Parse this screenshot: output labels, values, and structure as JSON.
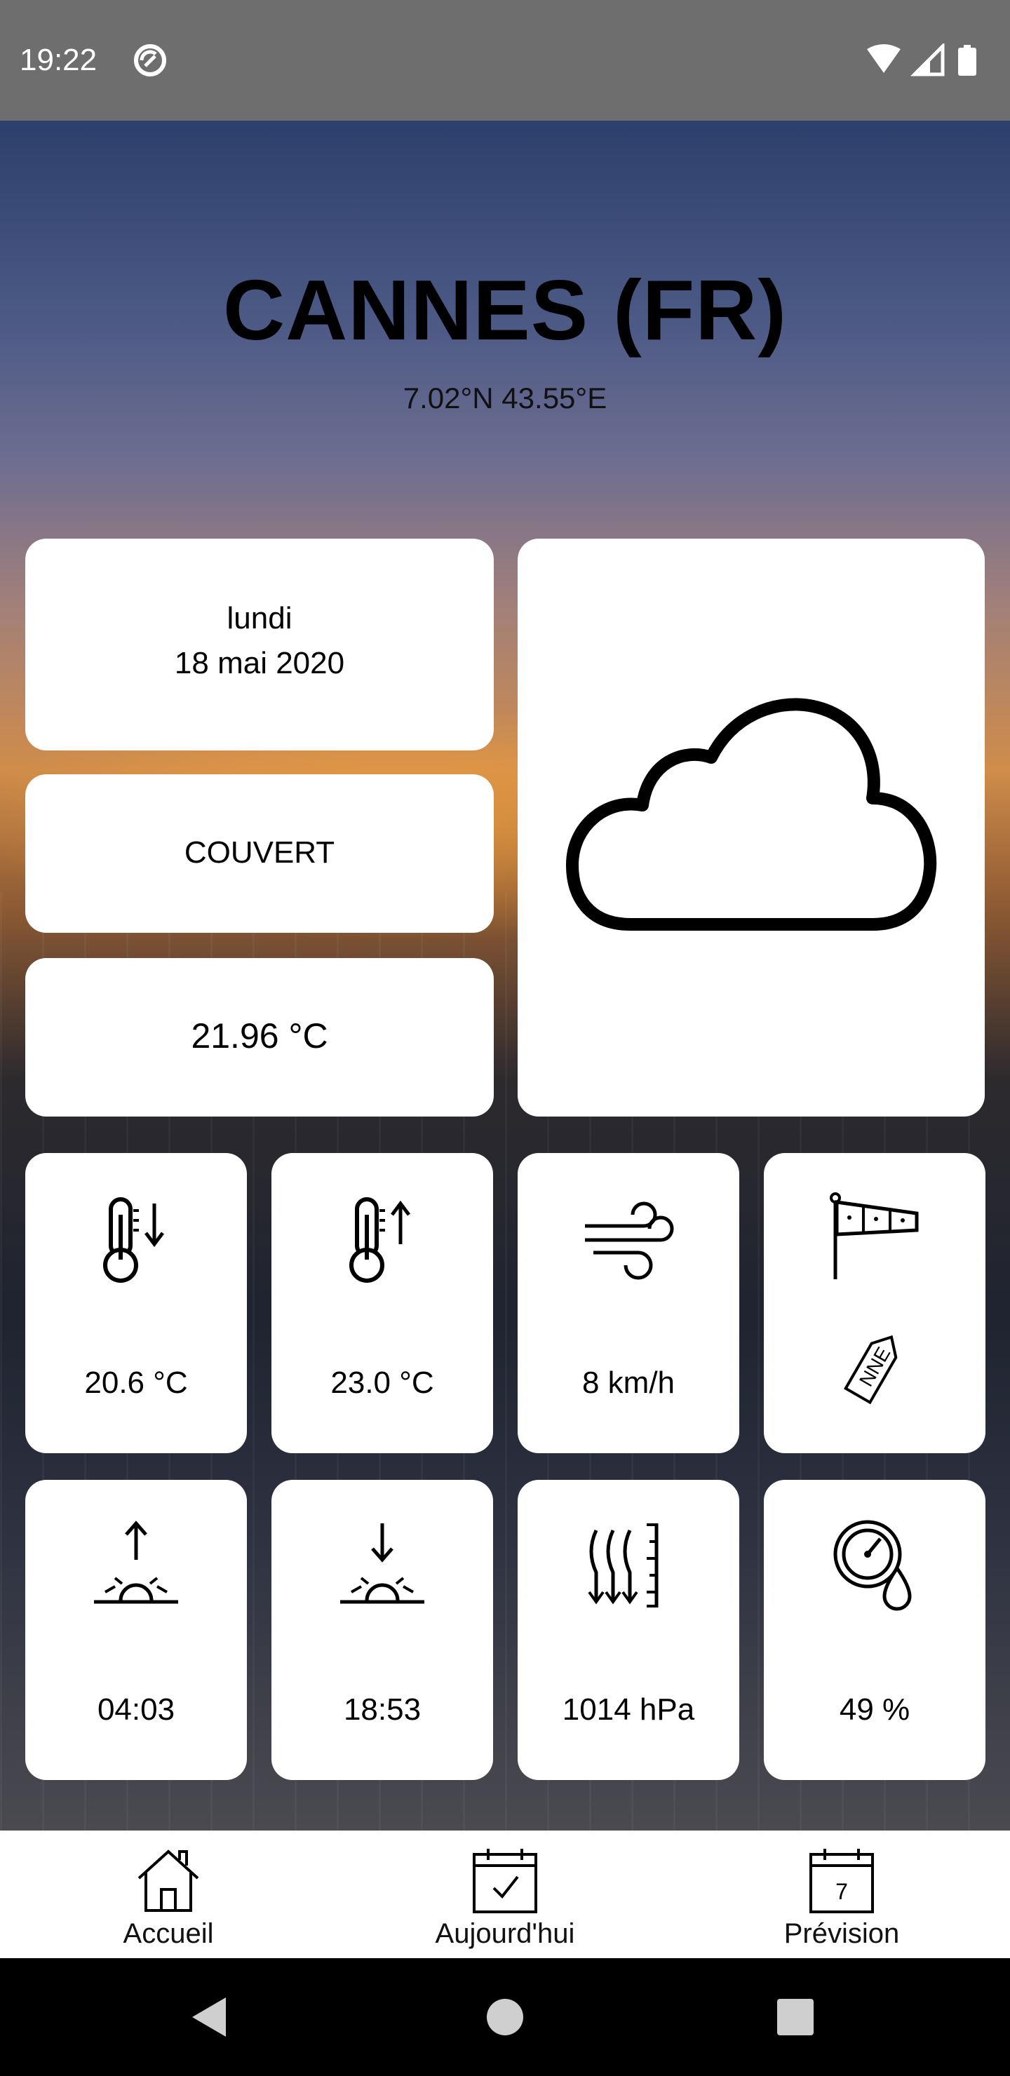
{
  "status_bar": {
    "time": "19:22",
    "icons": [
      "sync-icon",
      "wifi-icon",
      "signal-icon",
      "battery-icon"
    ]
  },
  "location": {
    "city": "CANNES (FR)",
    "coordinates": "7.02°N 43.55°E"
  },
  "date": {
    "day": "lundi",
    "full": "18 mai 2020"
  },
  "condition": {
    "label": "COUVERT",
    "icon": "cloud-icon"
  },
  "temperature": "21.96 °C",
  "details": {
    "temp_min": "20.6 °C",
    "temp_max": "23.0 °C",
    "wind_speed": "8 km/h",
    "wind_direction": "NNE",
    "sunrise": "04:03",
    "sunset": "18:53",
    "pressure": "1014 hPa",
    "humidity": "49 %"
  },
  "nav": {
    "home": "Accueil",
    "today": "Aujourd'hui",
    "forecast": "Prévision",
    "forecast_day": "7"
  },
  "colors": {
    "status_bar": "#6e6e6e",
    "card": "#ffffff",
    "text": "#000000",
    "system_nav": "#000000"
  }
}
